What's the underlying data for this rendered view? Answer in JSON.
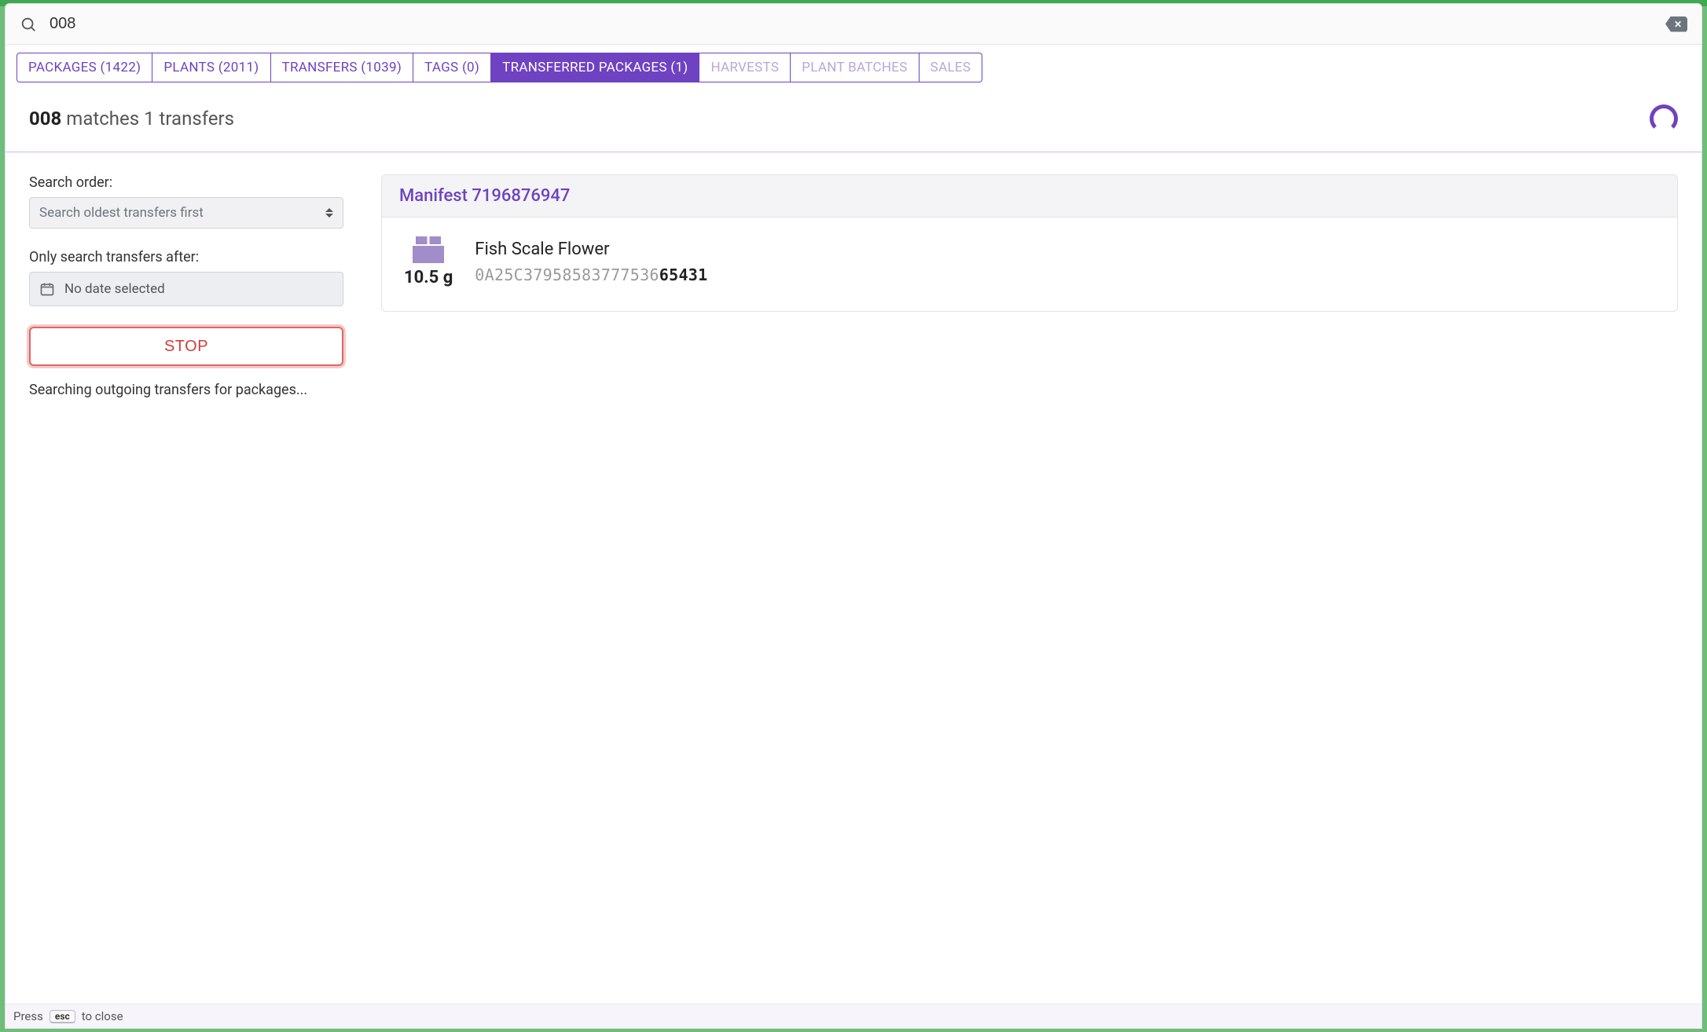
{
  "search": {
    "value": "008"
  },
  "tabs": [
    {
      "label": "PACKAGES (1422)"
    },
    {
      "label": "PLANTS (2011)"
    },
    {
      "label": "TRANSFERS (1039)"
    },
    {
      "label": "TAGS (0)"
    },
    {
      "label": "TRANSFERRED PACKAGES (1)"
    },
    {
      "label": "HARVESTS"
    },
    {
      "label": "PLANT BATCHES"
    },
    {
      "label": "SALES"
    }
  ],
  "active_tab_index": 4,
  "summary": {
    "query": "008",
    "rest": " matches 1 transfers"
  },
  "controls": {
    "search_order_label": "Search order:",
    "search_order_value": "Search oldest transfers first",
    "date_label": "Only search transfers after:",
    "date_value": "No date selected",
    "stop_label": "STOP",
    "status": "Searching outgoing transfers for packages..."
  },
  "result": {
    "manifest_label": "Manifest 7196876947",
    "weight": "10.5 g",
    "product_name": "Fish Scale Flower",
    "tag_prefix": "0A25C37958583777536",
    "tag_suffix": "65431"
  },
  "footer": {
    "press": "Press",
    "key": "esc",
    "rest": "to close"
  }
}
